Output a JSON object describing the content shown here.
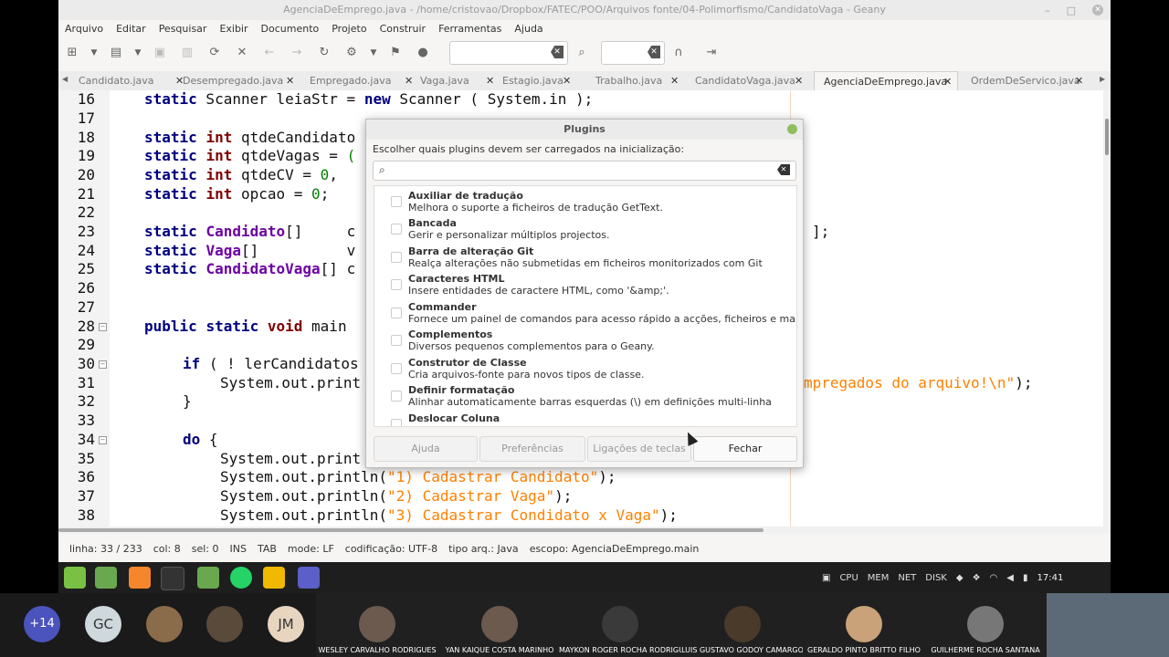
{
  "window": {
    "title": "AgenciaDeEmprego.java - /home/cristovao/Dropbox/FATEC/POO/Arquivos fonte/04-Polimorfismo/CandidatoVaga - Geany"
  },
  "menu": [
    "Arquivo",
    "Editar",
    "Pesquisar",
    "Exibir",
    "Documento",
    "Projeto",
    "Construir",
    "Ferramentas",
    "Ajuda"
  ],
  "tabs": [
    {
      "label": "Candidato.java",
      "active": false
    },
    {
      "label": "Desempregado.java",
      "active": false
    },
    {
      "label": "Empregado.java",
      "active": false
    },
    {
      "label": "Vaga.java",
      "active": false
    },
    {
      "label": "Estagio.java",
      "active": false
    },
    {
      "label": "Trabalho.java",
      "active": false
    },
    {
      "label": "CandidatoVaga.java",
      "active": false
    },
    {
      "label": "AgenciaDeEmprego.java",
      "active": true
    },
    {
      "label": "OrdemDeServico.java",
      "active": false
    }
  ],
  "tab_close_glyph": "✕",
  "editor": {
    "line_numbers": [
      "16",
      "17",
      "18",
      "19",
      "20",
      "21",
      "22",
      "23",
      "24",
      "25",
      "26",
      "27",
      "28",
      "29",
      "30",
      "31",
      "32",
      "33",
      "34",
      "35",
      "36",
      "37",
      "38"
    ],
    "visible": {
      "l16": [
        "static",
        " Scanner leiaStr = ",
        "new",
        " Scanner ( System.in );"
      ],
      "l18": [
        "static",
        " ",
        "int",
        " qtdeCandidato"
      ],
      "l19": [
        "static",
        " ",
        "int",
        " qtdeVagas = ",
        "("
      ],
      "l20": [
        "static",
        " ",
        "int",
        " qtdeCV = ",
        "0",
        ","
      ],
      "l21": [
        "static",
        " ",
        "int",
        " opcao = ",
        "0",
        ";"
      ],
      "l23": [
        "static",
        " ",
        "Candidato",
        "[]     ",
        "c"
      ],
      "l23_tail": "];",
      "l24": [
        "static",
        " ",
        "Vaga",
        "[]          ",
        "v"
      ],
      "l25": [
        "static",
        " ",
        "CandidatoVaga",
        "[] ",
        "c"
      ],
      "l28": [
        "public",
        " ",
        "static",
        " ",
        "void",
        " main"
      ],
      "l30": [
        "if",
        " ( ! lerCandidatos"
      ],
      "l31": [
        "System.out.print"
      ],
      "l31_tail": [
        "mpregados do arquivo!\\n\"",
        ");"
      ],
      "l32": [
        "}"
      ],
      "l34": [
        "do",
        " {"
      ],
      "l35": [
        "System.out.print"
      ],
      "l36": [
        "System.out.println(",
        "\"1) Cadastrar Candidato\"",
        ");"
      ],
      "l37": [
        "System.out.println(",
        "\"2) Cadastrar Vaga\"",
        ");"
      ],
      "l38": [
        "System.out.println(",
        "\"3) Cadastrar Condidato x Vaga\"",
        ");"
      ]
    }
  },
  "statusbar": {
    "line": "linha: 33 / 233",
    "col": "col: 8",
    "sel": "sel: 0",
    "ins": "INS",
    "tab": "TAB",
    "mode": "mode: LF",
    "encoding": "codificação: UTF-8",
    "filetype": "tipo arq.: Java",
    "scope": "escopo: AgenciaDeEmprego.main"
  },
  "dialog": {
    "title": "Plugins",
    "description": "Escolher quais plugins devem ser carregados na inicialização:",
    "search_placeholder": "",
    "plugins": [
      {
        "name": "Auxiliar de tradução",
        "desc": "Melhora o suporte a ficheiros de tradução GetText."
      },
      {
        "name": "Bancada",
        "desc": "Gerir e personalizar múltiplos projectos."
      },
      {
        "name": "Barra de alteração Git",
        "desc": "Realça alterações não submetidas em ficheiros monitorizados com Git"
      },
      {
        "name": "Caracteres HTML",
        "desc": "Insere entidades de caractere HTML, como '&amp;'."
      },
      {
        "name": "Commander",
        "desc": "Fornece um painel de comandos para acesso rápido a acções, ficheiros e mais."
      },
      {
        "name": "Complementos",
        "desc": "Diversos pequenos complementos para o Geany."
      },
      {
        "name": "Construtor de Classe",
        "desc": "Cria arquivos-fonte para novos tipos de classe."
      },
      {
        "name": "Definir formatação",
        "desc": "Alinhar automaticamente barras esquerdas (\\) em definições multi-linha"
      },
      {
        "name": "Deslocar Coluna",
        "desc": ""
      }
    ],
    "buttons": {
      "help": "Ajuda",
      "prefs": "Preferências",
      "keys": "Ligações de teclas",
      "close": "Fechar"
    }
  },
  "taskbar": {
    "monitors": [
      "CPU",
      "MEM",
      "NET",
      "DISK"
    ],
    "clock": "17:41"
  },
  "participants": {
    "more": "+14",
    "initials": [
      "GC",
      "JM"
    ],
    "names": [
      "WESLEY CARVALHO RODRIGUES",
      "YAN KAIQUE COSTA MARINHO",
      "MAYKON ROGER ROCHA RODRIGUES",
      "LUIS GUSTAVO GODOY CAMARGO",
      "GERALDO PINTO BRITTO FILHO",
      "GUILHERME ROCHA SANTANA"
    ]
  }
}
